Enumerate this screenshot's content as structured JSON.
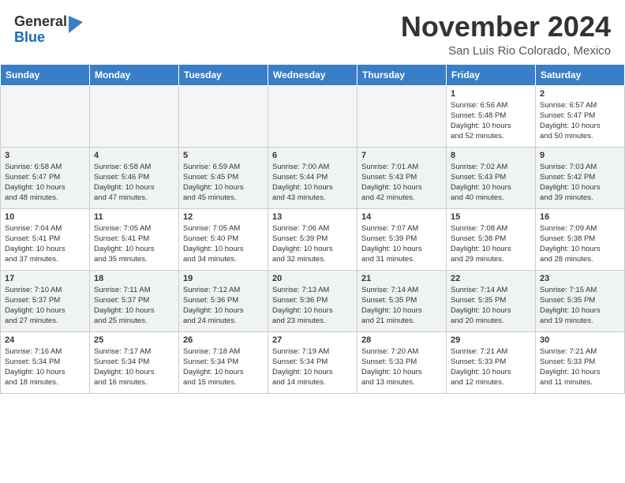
{
  "header": {
    "logo_general": "General",
    "logo_blue": "Blue",
    "month_title": "November 2024",
    "location": "San Luis Rio Colorado, Mexico"
  },
  "weekdays": [
    "Sunday",
    "Monday",
    "Tuesday",
    "Wednesday",
    "Thursday",
    "Friday",
    "Saturday"
  ],
  "weeks": [
    [
      {
        "day": "",
        "info": ""
      },
      {
        "day": "",
        "info": ""
      },
      {
        "day": "",
        "info": ""
      },
      {
        "day": "",
        "info": ""
      },
      {
        "day": "",
        "info": ""
      },
      {
        "day": "1",
        "info": "Sunrise: 6:56 AM\nSunset: 5:48 PM\nDaylight: 10 hours\nand 52 minutes."
      },
      {
        "day": "2",
        "info": "Sunrise: 6:57 AM\nSunset: 5:47 PM\nDaylight: 10 hours\nand 50 minutes."
      }
    ],
    [
      {
        "day": "3",
        "info": "Sunrise: 6:58 AM\nSunset: 5:47 PM\nDaylight: 10 hours\nand 48 minutes."
      },
      {
        "day": "4",
        "info": "Sunrise: 6:58 AM\nSunset: 5:46 PM\nDaylight: 10 hours\nand 47 minutes."
      },
      {
        "day": "5",
        "info": "Sunrise: 6:59 AM\nSunset: 5:45 PM\nDaylight: 10 hours\nand 45 minutes."
      },
      {
        "day": "6",
        "info": "Sunrise: 7:00 AM\nSunset: 5:44 PM\nDaylight: 10 hours\nand 43 minutes."
      },
      {
        "day": "7",
        "info": "Sunrise: 7:01 AM\nSunset: 5:43 PM\nDaylight: 10 hours\nand 42 minutes."
      },
      {
        "day": "8",
        "info": "Sunrise: 7:02 AM\nSunset: 5:43 PM\nDaylight: 10 hours\nand 40 minutes."
      },
      {
        "day": "9",
        "info": "Sunrise: 7:03 AM\nSunset: 5:42 PM\nDaylight: 10 hours\nand 39 minutes."
      }
    ],
    [
      {
        "day": "10",
        "info": "Sunrise: 7:04 AM\nSunset: 5:41 PM\nDaylight: 10 hours\nand 37 minutes."
      },
      {
        "day": "11",
        "info": "Sunrise: 7:05 AM\nSunset: 5:41 PM\nDaylight: 10 hours\nand 35 minutes."
      },
      {
        "day": "12",
        "info": "Sunrise: 7:05 AM\nSunset: 5:40 PM\nDaylight: 10 hours\nand 34 minutes."
      },
      {
        "day": "13",
        "info": "Sunrise: 7:06 AM\nSunset: 5:39 PM\nDaylight: 10 hours\nand 32 minutes."
      },
      {
        "day": "14",
        "info": "Sunrise: 7:07 AM\nSunset: 5:39 PM\nDaylight: 10 hours\nand 31 minutes."
      },
      {
        "day": "15",
        "info": "Sunrise: 7:08 AM\nSunset: 5:38 PM\nDaylight: 10 hours\nand 29 minutes."
      },
      {
        "day": "16",
        "info": "Sunrise: 7:09 AM\nSunset: 5:38 PM\nDaylight: 10 hours\nand 28 minutes."
      }
    ],
    [
      {
        "day": "17",
        "info": "Sunrise: 7:10 AM\nSunset: 5:37 PM\nDaylight: 10 hours\nand 27 minutes."
      },
      {
        "day": "18",
        "info": "Sunrise: 7:11 AM\nSunset: 5:37 PM\nDaylight: 10 hours\nand 25 minutes."
      },
      {
        "day": "19",
        "info": "Sunrise: 7:12 AM\nSunset: 5:36 PM\nDaylight: 10 hours\nand 24 minutes."
      },
      {
        "day": "20",
        "info": "Sunrise: 7:13 AM\nSunset: 5:36 PM\nDaylight: 10 hours\nand 23 minutes."
      },
      {
        "day": "21",
        "info": "Sunrise: 7:14 AM\nSunset: 5:35 PM\nDaylight: 10 hours\nand 21 minutes."
      },
      {
        "day": "22",
        "info": "Sunrise: 7:14 AM\nSunset: 5:35 PM\nDaylight: 10 hours\nand 20 minutes."
      },
      {
        "day": "23",
        "info": "Sunrise: 7:15 AM\nSunset: 5:35 PM\nDaylight: 10 hours\nand 19 minutes."
      }
    ],
    [
      {
        "day": "24",
        "info": "Sunrise: 7:16 AM\nSunset: 5:34 PM\nDaylight: 10 hours\nand 18 minutes."
      },
      {
        "day": "25",
        "info": "Sunrise: 7:17 AM\nSunset: 5:34 PM\nDaylight: 10 hours\nand 16 minutes."
      },
      {
        "day": "26",
        "info": "Sunrise: 7:18 AM\nSunset: 5:34 PM\nDaylight: 10 hours\nand 15 minutes."
      },
      {
        "day": "27",
        "info": "Sunrise: 7:19 AM\nSunset: 5:34 PM\nDaylight: 10 hours\nand 14 minutes."
      },
      {
        "day": "28",
        "info": "Sunrise: 7:20 AM\nSunset: 5:33 PM\nDaylight: 10 hours\nand 13 minutes."
      },
      {
        "day": "29",
        "info": "Sunrise: 7:21 AM\nSunset: 5:33 PM\nDaylight: 10 hours\nand 12 minutes."
      },
      {
        "day": "30",
        "info": "Sunrise: 7:21 AM\nSunset: 5:33 PM\nDaylight: 10 hours\nand 11 minutes."
      }
    ]
  ]
}
